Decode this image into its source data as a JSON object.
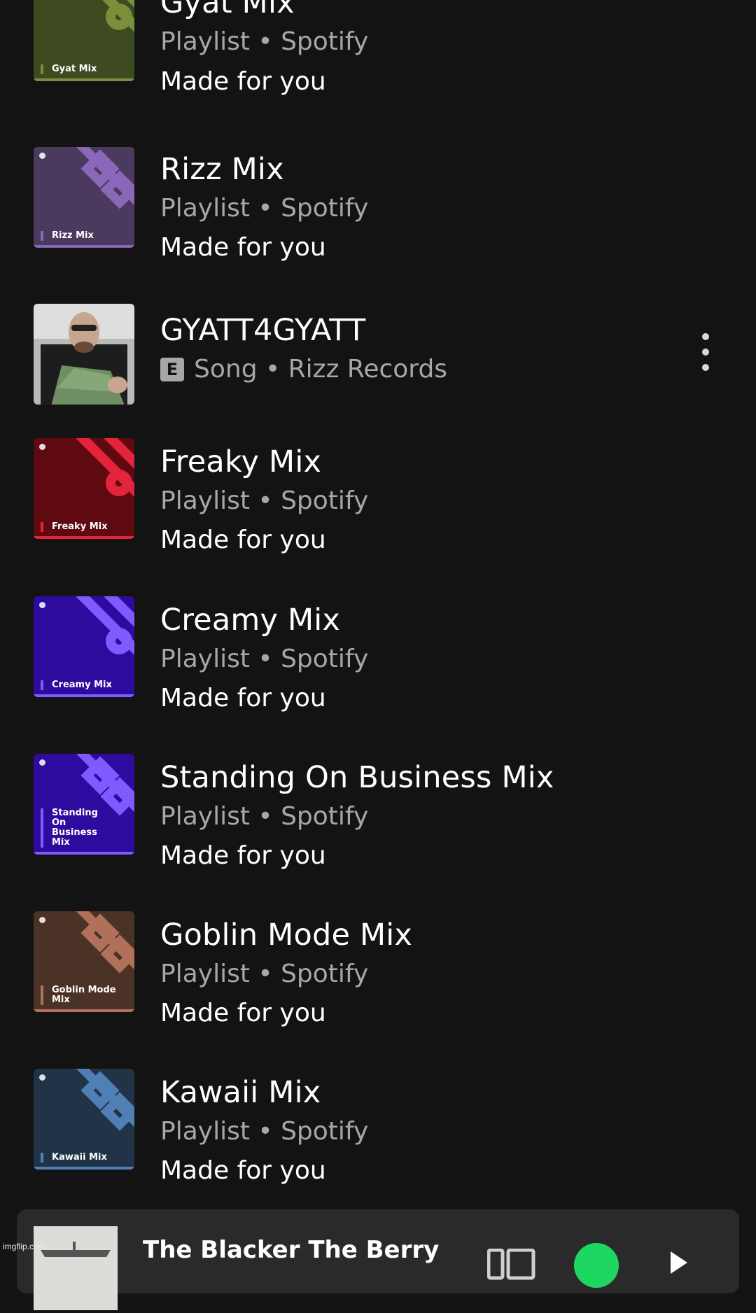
{
  "items": [
    {
      "title": "Gyat Mix",
      "meta": "Playlist • Spotify",
      "made": "Made for you",
      "cover_label": "Gyat Mix",
      "color": "#3e4a1f",
      "accent": "#7b8f3a"
    },
    {
      "title": "Rizz Mix",
      "meta": "Playlist • Spotify",
      "made": "Made for you",
      "cover_label": "Rizz Mix",
      "color": "#4a3b5e",
      "accent": "#8a67b8"
    },
    {
      "title": "GYATT4GYATT",
      "meta": "Song • Rizz Records",
      "explicit": "E"
    },
    {
      "title": "Freaky Mix",
      "meta": "Playlist • Spotify",
      "made": "Made for you",
      "cover_label": "Freaky Mix",
      "color": "#5e0a10",
      "accent": "#e3243a"
    },
    {
      "title": "Creamy Mix",
      "meta": "Playlist • Spotify",
      "made": "Made for you",
      "cover_label": "Creamy Mix",
      "color": "#2d0b9e",
      "accent": "#7f5bff"
    },
    {
      "title": "Standing On Business Mix",
      "meta": "Playlist • Spotify",
      "made": "Made for you",
      "cover_label": "Standing On Business Mix",
      "color": "#2d0b9e",
      "accent": "#7f5bff"
    },
    {
      "title": "Goblin Mode Mix",
      "meta": "Playlist • Spotify",
      "made": "Made for you",
      "cover_label": "Goblin Mode Mix",
      "color": "#4b3226",
      "accent": "#b0705a"
    },
    {
      "title": "Kawaii Mix",
      "meta": "Playlist • Spotify",
      "made": "Made for you",
      "cover_label": "Kawaii Mix",
      "color": "#213447",
      "accent": "#4f7fb4"
    }
  ],
  "player": {
    "track": "The Blacker The Berry"
  },
  "watermark": "imgflip.com"
}
